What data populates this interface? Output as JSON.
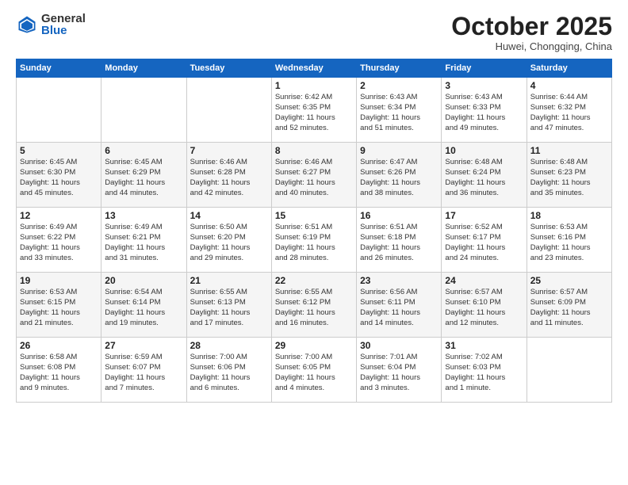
{
  "header": {
    "logo_general": "General",
    "logo_blue": "Blue",
    "month_title": "October 2025",
    "location": "Huwei, Chongqing, China"
  },
  "weekdays": [
    "Sunday",
    "Monday",
    "Tuesday",
    "Wednesday",
    "Thursday",
    "Friday",
    "Saturday"
  ],
  "weeks": [
    [
      {
        "day": "",
        "info": ""
      },
      {
        "day": "",
        "info": ""
      },
      {
        "day": "",
        "info": ""
      },
      {
        "day": "1",
        "info": "Sunrise: 6:42 AM\nSunset: 6:35 PM\nDaylight: 11 hours\nand 52 minutes."
      },
      {
        "day": "2",
        "info": "Sunrise: 6:43 AM\nSunset: 6:34 PM\nDaylight: 11 hours\nand 51 minutes."
      },
      {
        "day": "3",
        "info": "Sunrise: 6:43 AM\nSunset: 6:33 PM\nDaylight: 11 hours\nand 49 minutes."
      },
      {
        "day": "4",
        "info": "Sunrise: 6:44 AM\nSunset: 6:32 PM\nDaylight: 11 hours\nand 47 minutes."
      }
    ],
    [
      {
        "day": "5",
        "info": "Sunrise: 6:45 AM\nSunset: 6:30 PM\nDaylight: 11 hours\nand 45 minutes."
      },
      {
        "day": "6",
        "info": "Sunrise: 6:45 AM\nSunset: 6:29 PM\nDaylight: 11 hours\nand 44 minutes."
      },
      {
        "day": "7",
        "info": "Sunrise: 6:46 AM\nSunset: 6:28 PM\nDaylight: 11 hours\nand 42 minutes."
      },
      {
        "day": "8",
        "info": "Sunrise: 6:46 AM\nSunset: 6:27 PM\nDaylight: 11 hours\nand 40 minutes."
      },
      {
        "day": "9",
        "info": "Sunrise: 6:47 AM\nSunset: 6:26 PM\nDaylight: 11 hours\nand 38 minutes."
      },
      {
        "day": "10",
        "info": "Sunrise: 6:48 AM\nSunset: 6:24 PM\nDaylight: 11 hours\nand 36 minutes."
      },
      {
        "day": "11",
        "info": "Sunrise: 6:48 AM\nSunset: 6:23 PM\nDaylight: 11 hours\nand 35 minutes."
      }
    ],
    [
      {
        "day": "12",
        "info": "Sunrise: 6:49 AM\nSunset: 6:22 PM\nDaylight: 11 hours\nand 33 minutes."
      },
      {
        "day": "13",
        "info": "Sunrise: 6:49 AM\nSunset: 6:21 PM\nDaylight: 11 hours\nand 31 minutes."
      },
      {
        "day": "14",
        "info": "Sunrise: 6:50 AM\nSunset: 6:20 PM\nDaylight: 11 hours\nand 29 minutes."
      },
      {
        "day": "15",
        "info": "Sunrise: 6:51 AM\nSunset: 6:19 PM\nDaylight: 11 hours\nand 28 minutes."
      },
      {
        "day": "16",
        "info": "Sunrise: 6:51 AM\nSunset: 6:18 PM\nDaylight: 11 hours\nand 26 minutes."
      },
      {
        "day": "17",
        "info": "Sunrise: 6:52 AM\nSunset: 6:17 PM\nDaylight: 11 hours\nand 24 minutes."
      },
      {
        "day": "18",
        "info": "Sunrise: 6:53 AM\nSunset: 6:16 PM\nDaylight: 11 hours\nand 23 minutes."
      }
    ],
    [
      {
        "day": "19",
        "info": "Sunrise: 6:53 AM\nSunset: 6:15 PM\nDaylight: 11 hours\nand 21 minutes."
      },
      {
        "day": "20",
        "info": "Sunrise: 6:54 AM\nSunset: 6:14 PM\nDaylight: 11 hours\nand 19 minutes."
      },
      {
        "day": "21",
        "info": "Sunrise: 6:55 AM\nSunset: 6:13 PM\nDaylight: 11 hours\nand 17 minutes."
      },
      {
        "day": "22",
        "info": "Sunrise: 6:55 AM\nSunset: 6:12 PM\nDaylight: 11 hours\nand 16 minutes."
      },
      {
        "day": "23",
        "info": "Sunrise: 6:56 AM\nSunset: 6:11 PM\nDaylight: 11 hours\nand 14 minutes."
      },
      {
        "day": "24",
        "info": "Sunrise: 6:57 AM\nSunset: 6:10 PM\nDaylight: 11 hours\nand 12 minutes."
      },
      {
        "day": "25",
        "info": "Sunrise: 6:57 AM\nSunset: 6:09 PM\nDaylight: 11 hours\nand 11 minutes."
      }
    ],
    [
      {
        "day": "26",
        "info": "Sunrise: 6:58 AM\nSunset: 6:08 PM\nDaylight: 11 hours\nand 9 minutes."
      },
      {
        "day": "27",
        "info": "Sunrise: 6:59 AM\nSunset: 6:07 PM\nDaylight: 11 hours\nand 7 minutes."
      },
      {
        "day": "28",
        "info": "Sunrise: 7:00 AM\nSunset: 6:06 PM\nDaylight: 11 hours\nand 6 minutes."
      },
      {
        "day": "29",
        "info": "Sunrise: 7:00 AM\nSunset: 6:05 PM\nDaylight: 11 hours\nand 4 minutes."
      },
      {
        "day": "30",
        "info": "Sunrise: 7:01 AM\nSunset: 6:04 PM\nDaylight: 11 hours\nand 3 minutes."
      },
      {
        "day": "31",
        "info": "Sunrise: 7:02 AM\nSunset: 6:03 PM\nDaylight: 11 hours\nand 1 minute."
      },
      {
        "day": "",
        "info": ""
      }
    ]
  ]
}
